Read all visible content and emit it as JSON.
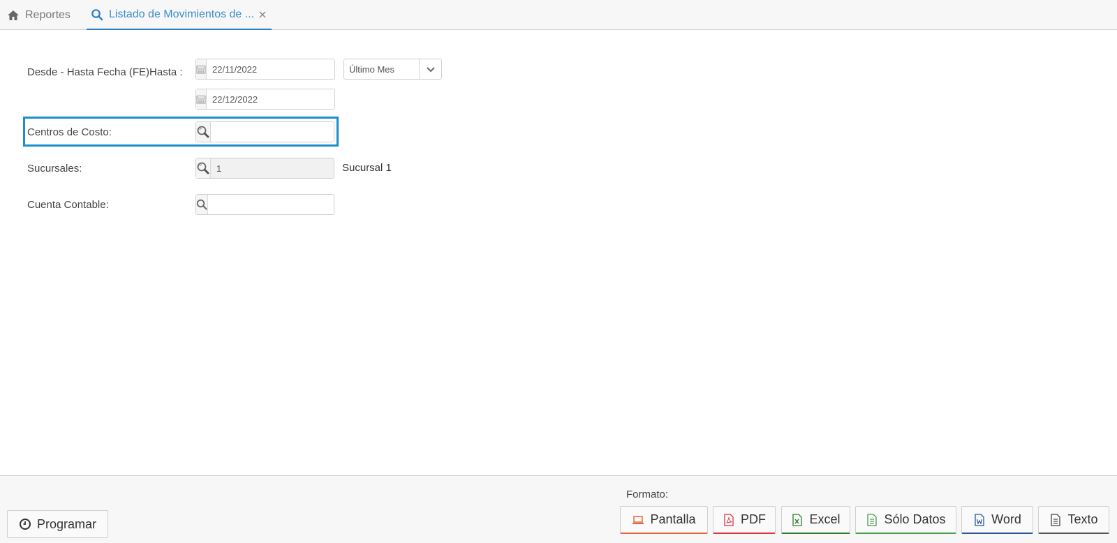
{
  "tabs": [
    {
      "label": "Reportes",
      "icon": "home-icon"
    },
    {
      "label": "Listado de Movimientos de ...",
      "icon": "search-icon",
      "active": true
    }
  ],
  "form": {
    "fecha": {
      "label": "Desde - Hasta Fecha (FE)Hasta :",
      "desde": "22/11/2022",
      "hasta": "22/12/2022",
      "preset": "Último Mes"
    },
    "centros": {
      "label": "Centros de Costo:",
      "value": ""
    },
    "sucursales": {
      "label": "Sucursales:",
      "value": "1",
      "description": "Sucursal 1"
    },
    "cuenta": {
      "label": "Cuenta Contable:",
      "value": ""
    }
  },
  "footer": {
    "programar": "Programar",
    "formato_label": "Formato:",
    "formats": [
      {
        "label": "Pantalla",
        "color": "#e8673a"
      },
      {
        "label": "PDF",
        "color": "#d9363e"
      },
      {
        "label": "Excel",
        "color": "#2e7d32"
      },
      {
        "label": "Sólo Datos",
        "color": "#43a047"
      },
      {
        "label": "Word",
        "color": "#2b579a"
      },
      {
        "label": "Texto",
        "color": "#555555"
      }
    ]
  }
}
